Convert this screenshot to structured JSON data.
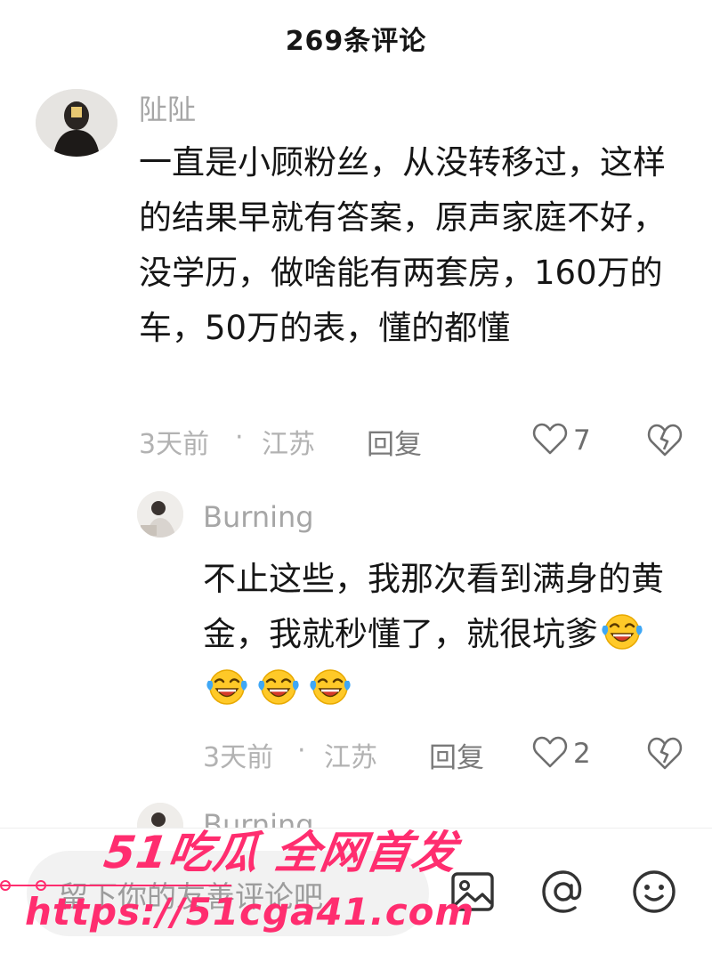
{
  "header": {
    "title": "269条评论"
  },
  "comments": [
    {
      "username": "阯阯",
      "text": "一直是小顾粉丝，从没转移过，这样的结果早就有答案，原声家庭不好，没学历，做啥能有两套房，160万的车，50万的表，懂的都懂",
      "time": "3天前",
      "separator": "·",
      "location": "江苏",
      "reply_label": "回复",
      "likes": "7"
    }
  ],
  "replies": [
    {
      "username": "Burning",
      "text": "不止这些，我那次看到满身的黄金，我就秒懂了，就很坑爹",
      "emoji_name": "laughing-crying-emoji",
      "emoji_count": 4,
      "time": "3天前",
      "separator": "·",
      "location": "江苏",
      "reply_label": "回复",
      "likes": "2"
    },
    {
      "username": "Burning"
    }
  ],
  "bottom_bar": {
    "placeholder": "留下你的友善评论吧",
    "icons": [
      "image-icon",
      "at-icon",
      "emoji-icon"
    ]
  },
  "watermark": {
    "brand": "51吃瓜 全网首发",
    "url": "https://51cga41.com",
    "color": "#ff2d6f"
  }
}
